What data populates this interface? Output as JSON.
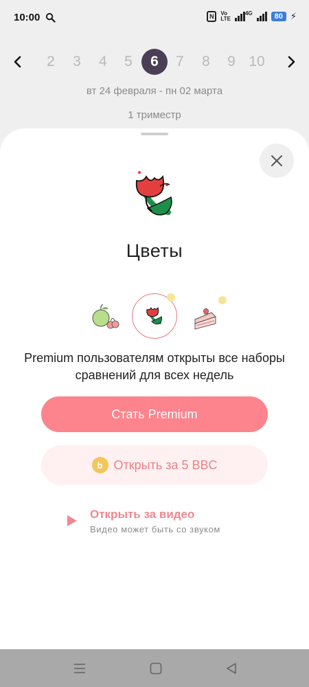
{
  "status_bar": {
    "time": "10:00",
    "volte_top": "Vo",
    "volte_bottom": "LTE",
    "network": "4G",
    "battery": "80"
  },
  "week_nav": {
    "weeks": [
      "2",
      "3",
      "4",
      "5",
      "6",
      "7",
      "8",
      "9",
      "10"
    ],
    "selected": "6",
    "date_range": "вт 24 февраля - пн 02 марта",
    "trimester": "1 триместр"
  },
  "sheet": {
    "title": "Цветы",
    "sets": [
      "apple-cherry-icon",
      "flower-icon",
      "cake-icon"
    ],
    "description": "Premium пользователям открыты все наборы сравнений для всех недель",
    "premium_button": "Стать Premium",
    "coins_button": "Открыть за 5 BBC",
    "coin_symbol": "b",
    "video_title": "Открыть за видео",
    "video_subtitle": "Видео может быть со звуком"
  },
  "colors": {
    "accent": "#fd838d",
    "accent_light": "#fff1f1",
    "selected_week": "#4a3f55",
    "coin": "#f4c55a"
  }
}
